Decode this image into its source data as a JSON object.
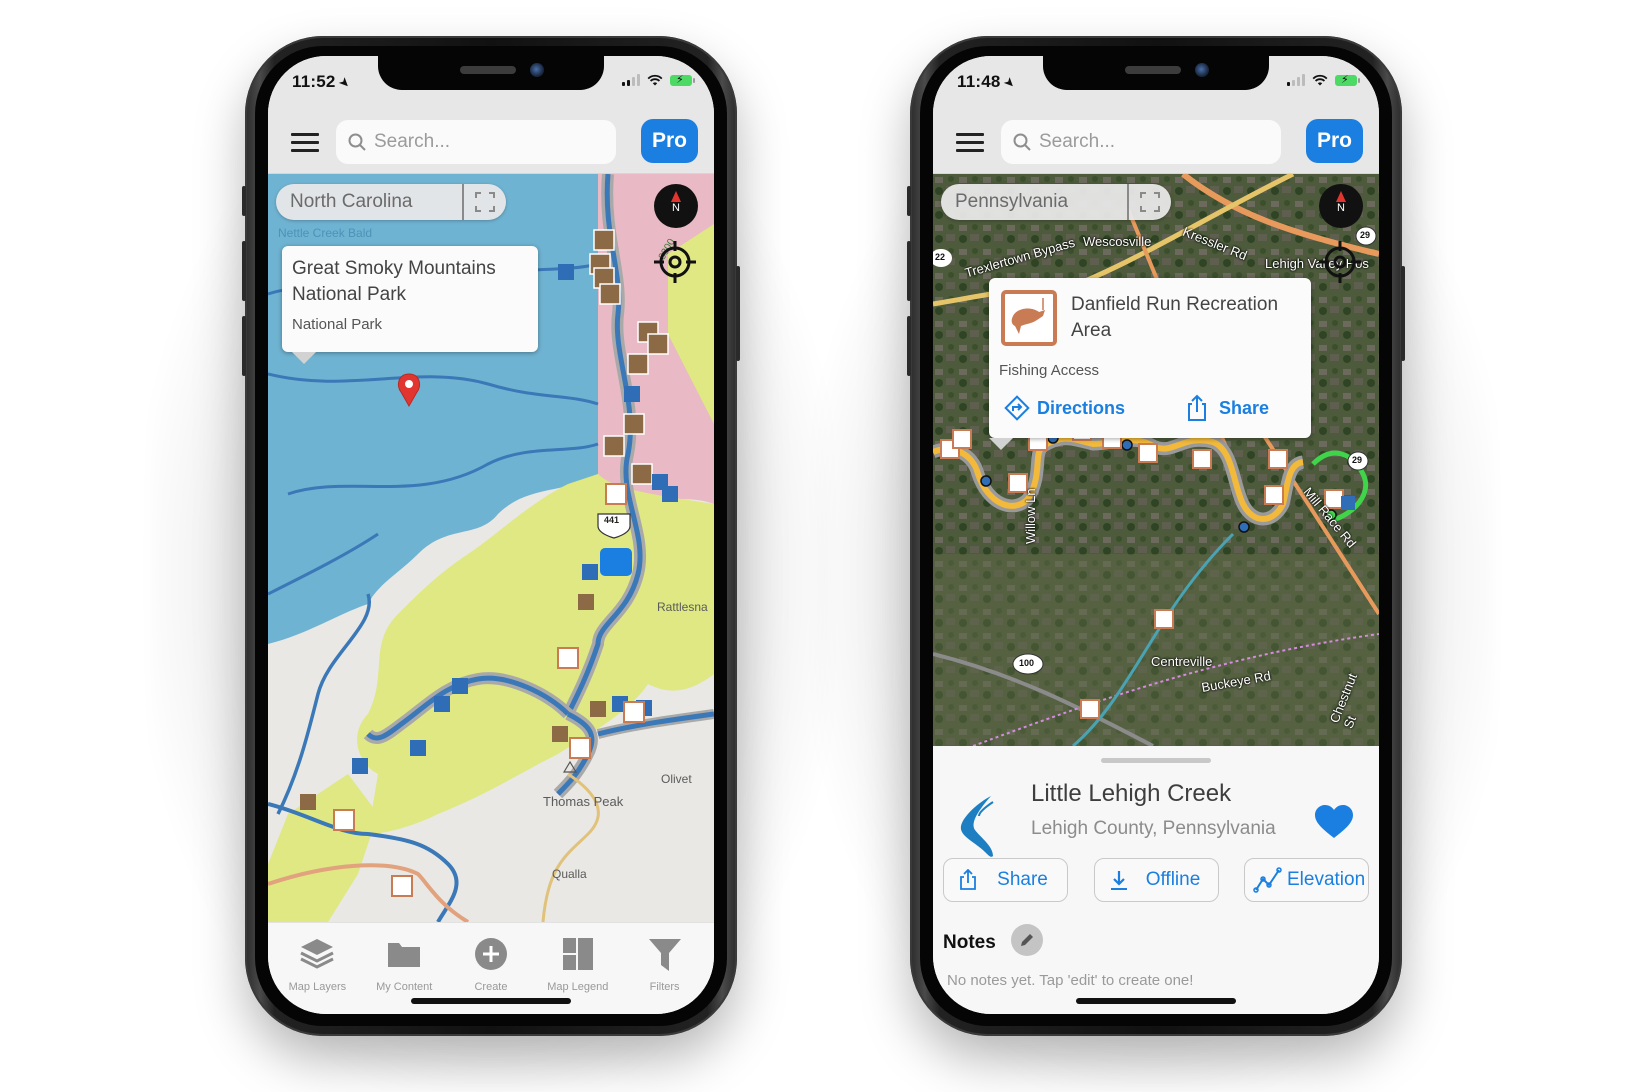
{
  "phones": [
    {
      "status": {
        "time": "11:52"
      },
      "header": {
        "search_placeholder": "Search...",
        "pro_label": "Pro"
      },
      "map": {
        "region": "North Carolina",
        "labels": {
          "nettle_creek_bald": "Nettle Creek Bald",
          "rattlesnake": "Rattlesna",
          "olivet": "Olivet",
          "thomas_peak": "Thomas Peak",
          "qualla": "Qualla",
          "route_441": "441",
          "contour_3300": "3300"
        },
        "callout": {
          "title": "Great Smoky Mountains National Park",
          "subtitle": "National Park"
        }
      },
      "tabbar": [
        {
          "icon": "layers-icon",
          "label": "Map Layers"
        },
        {
          "icon": "folder-icon",
          "label": "My Content"
        },
        {
          "icon": "plus-circle-icon",
          "label": "Create"
        },
        {
          "icon": "legend-icon",
          "label": "Map Legend"
        },
        {
          "icon": "filter-icon",
          "label": "Filters"
        }
      ]
    },
    {
      "status": {
        "time": "11:48"
      },
      "header": {
        "search_placeholder": "Search...",
        "pro_label": "Pro"
      },
      "map": {
        "region": "Pennsylvania",
        "labels": {
          "wescosville": "Wescosville",
          "trexlertown_bypass": "Trexlertown Bypass",
          "kressler_rd": "Kressler Rd",
          "lehigh_valley": "Lehigh Valley Hos",
          "willow_ln": "Willow Ln",
          "mill_race_rd": "Mill Race Rd",
          "centreville": "Centreville",
          "buckeye_rd": "Buckeye Rd",
          "chestnut_st": "Chestnut St",
          "route_22": "22",
          "route_29a": "29",
          "route_29b": "29",
          "route_100": "100"
        },
        "callout": {
          "icon": "fishing-access-icon",
          "title": "Danfield Run Recreation Area",
          "subtitle": "Fishing Access",
          "directions_label": "Directions",
          "share_label": "Share"
        }
      },
      "detail": {
        "title": "Little Lehigh Creek",
        "subtitle": "Lehigh County, Pennsylvania",
        "favorited": true,
        "actions": [
          {
            "icon": "share-icon",
            "label": "Share"
          },
          {
            "icon": "download-icon",
            "label": "Offline"
          },
          {
            "icon": "elevation-icon",
            "label": "Elevation"
          }
        ],
        "notes_heading": "Notes",
        "notes_empty": "No notes yet. Tap 'edit' to create one!"
      }
    }
  ],
  "colors": {
    "accent": "#1a7fe0",
    "park_blue": "#6fb3d2",
    "forest_yellow": "#dfe883",
    "private_pink": "#e9b9c5",
    "river_blue": "#3a78b8",
    "poi_brown": "#8b6a45",
    "fishing_orange": "#c97b54",
    "pin_red": "#e2352f"
  }
}
